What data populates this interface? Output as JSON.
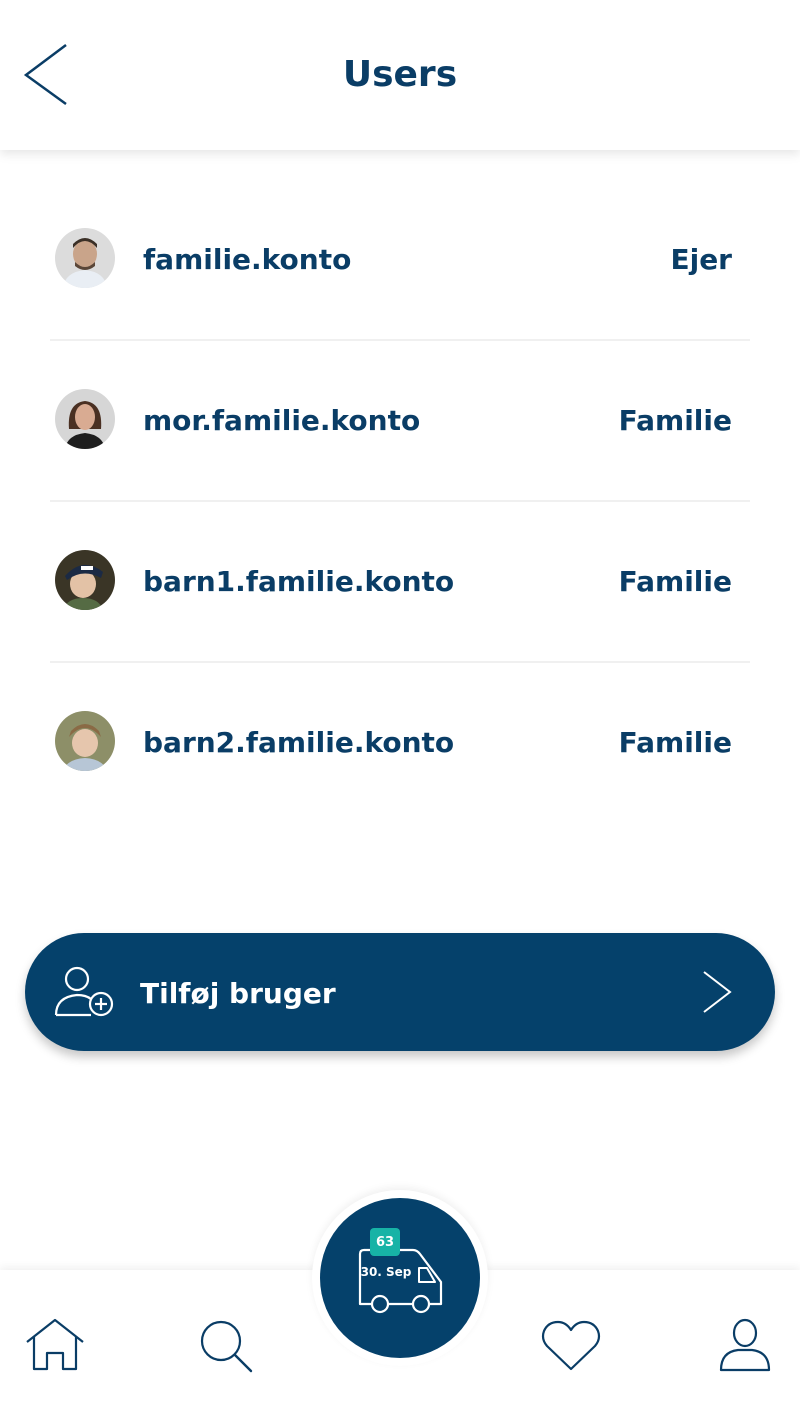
{
  "header": {
    "title": "Users"
  },
  "users": [
    {
      "username": "familie.konto",
      "role": "Ejer"
    },
    {
      "username": "mor.familie.konto",
      "role": "Familie"
    },
    {
      "username": "barn1.familie.konto",
      "role": "Familie"
    },
    {
      "username": "barn2.familie.konto",
      "role": "Familie"
    }
  ],
  "add_user": {
    "label": "Tilføj bruger"
  },
  "delivery": {
    "badge_count": "63",
    "date": "30. Sep"
  },
  "bottom_nav": {
    "items": [
      "home-icon",
      "search-icon",
      "heart-icon",
      "user-icon"
    ]
  },
  "colors": {
    "primary": "#05416b",
    "accent": "#17b3a6",
    "text": "#0a3d66"
  }
}
